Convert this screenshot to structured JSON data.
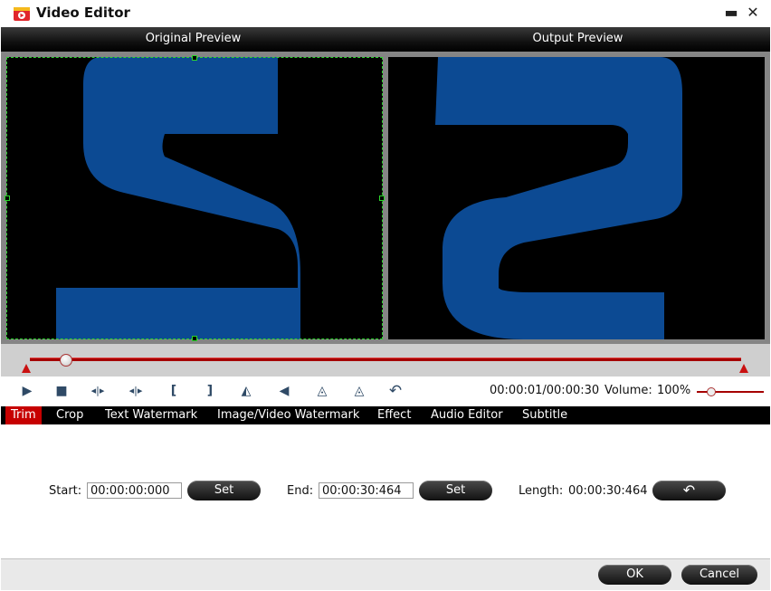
{
  "window": {
    "title": "Video Editor",
    "minimize_glyph": "▬",
    "close_glyph": "✕",
    "app_icon": "film-icon"
  },
  "preview": {
    "original_label": "Original Preview",
    "output_label": "Output Preview"
  },
  "playback": {
    "position_fraction": 0.05
  },
  "controls": {
    "icons": [
      "play-icon",
      "stop-icon",
      "prev-frame-icon",
      "next-frame-icon",
      "mark-in-icon",
      "mark-out-icon",
      "flip-horizontal-icon",
      "flip-vertical-icon",
      "rotate-left-icon",
      "rotate-right-icon",
      "undo-icon"
    ],
    "glyphs": {
      "play": "▶",
      "stop": "■",
      "prev": "◂|▸",
      "next": "◂|▸",
      "mark_in": "[",
      "mark_out": "]",
      "flip_h": "◭",
      "flip_v": "◀",
      "rot_l": "◬",
      "rot_r": "◬",
      "undo": "↶"
    },
    "time": "00:00:01/00:00:30",
    "volume_label": "Volume:",
    "volume_value": "100%",
    "volume_fraction": 0.2
  },
  "tabs": [
    "Trim",
    "Crop",
    "Text Watermark",
    "Image/Video Watermark",
    "Effect",
    "Audio Editor",
    "Subtitle"
  ],
  "active_tab": "Trim",
  "trim": {
    "start_label": "Start:",
    "start_value": "00:00:00:000",
    "end_label": "End:",
    "end_value": "00:00:30:464",
    "set_label": "Set",
    "length_label": "Length:",
    "length_value": "00:00:30:464",
    "reset_glyph": "↶"
  },
  "footer": {
    "ok_label": "OK",
    "cancel_label": "Cancel"
  },
  "colors": {
    "accent_red": "#c70000",
    "preview_blue": "#0c4a93",
    "crop_green": "#2bd42b"
  }
}
